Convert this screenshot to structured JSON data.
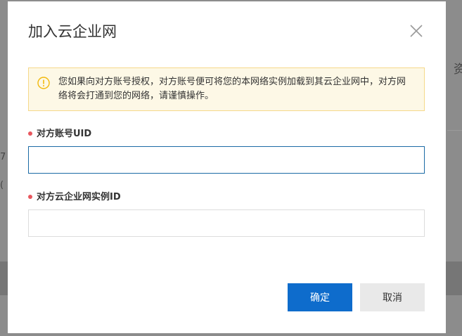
{
  "background": {
    "right_fragment": "资",
    "left_fragment_1": "7",
    "left_fragment_2": "("
  },
  "dialog": {
    "title": "加入云企业网",
    "close_icon": "close-icon",
    "alert": {
      "icon": "warning-icon",
      "text": "您如果向对方账号授权，对方账号便可将您的本网络实例加载到其云企业网中，对方网络将会打通到您的网络，请谨慎操作。"
    },
    "fields": [
      {
        "label": "对方账号UID",
        "value": "",
        "placeholder": ""
      },
      {
        "label": "对方云企业网实例ID",
        "value": "",
        "placeholder": ""
      }
    ],
    "buttons": {
      "confirm": "确定",
      "cancel": "取消"
    },
    "colors": {
      "primary": "#0e6ccc",
      "required_dot": "#e8575e",
      "alert_bg": "#fdf8e6",
      "alert_border": "#f5d98a",
      "focus_border": "#1b6aa5"
    }
  }
}
